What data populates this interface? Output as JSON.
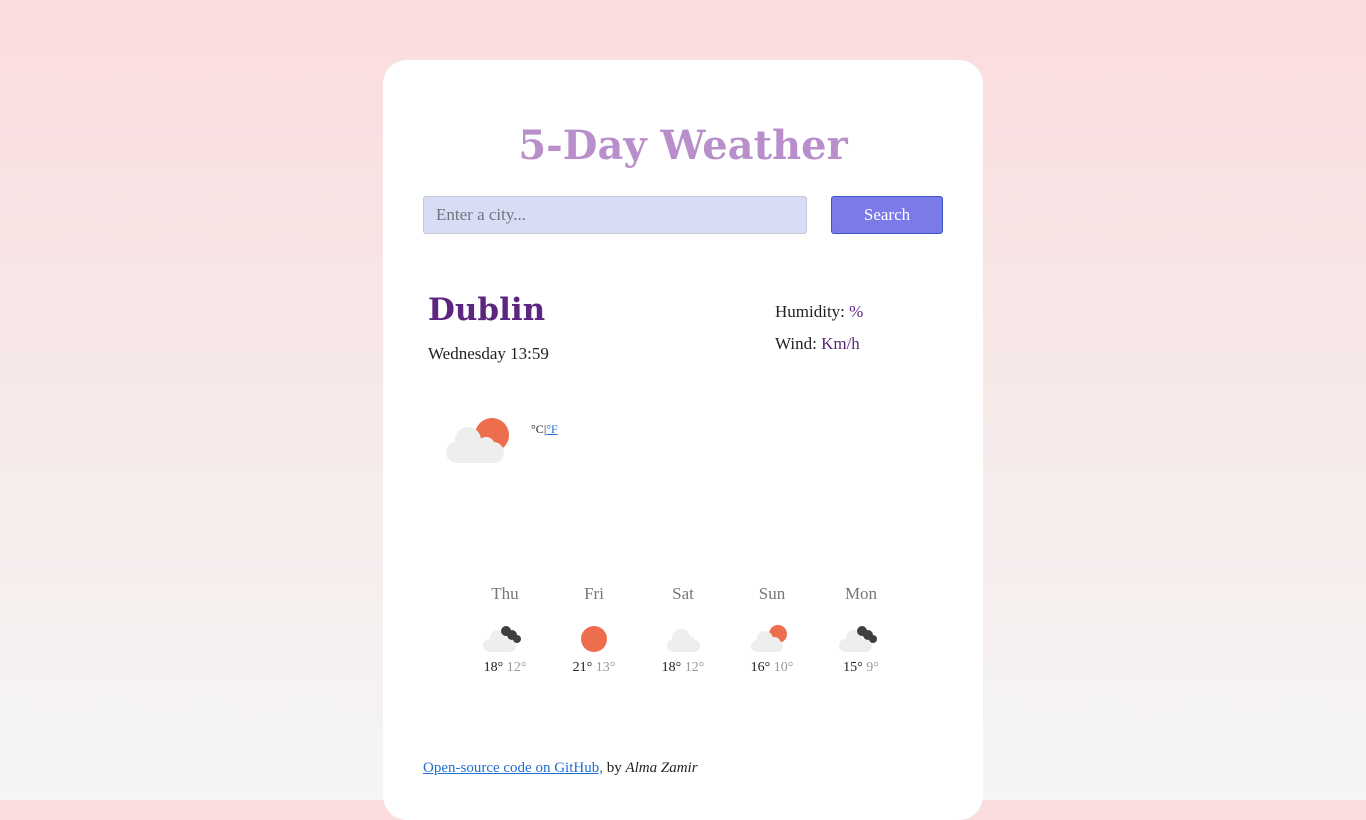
{
  "header": {
    "title": "5-Day Weather"
  },
  "search": {
    "placeholder": "Enter a city...",
    "button_label": "Search"
  },
  "current": {
    "city": "Dublin",
    "datetime": "Wednesday 13:59",
    "humidity_label": "Humidity:",
    "humidity_value": "%",
    "wind_label": "Wind:",
    "wind_value": "Km/h",
    "icon": "partly-cloudy-day-icon",
    "unit_celsius": "°C",
    "unit_separator": "|",
    "unit_fahrenheit": "°F"
  },
  "forecast": [
    {
      "day": "Thu",
      "max": "18°",
      "min": "12°",
      "icon": "cloudy-night-icon"
    },
    {
      "day": "Fri",
      "max": "21°",
      "min": "13°",
      "icon": "sun-icon"
    },
    {
      "day": "Sat",
      "max": "18°",
      "min": "12°",
      "icon": "cloud-icon"
    },
    {
      "day": "Sun",
      "max": "16°",
      "min": "10°",
      "icon": "partly-cloudy-day-icon"
    },
    {
      "day": "Mon",
      "max": "15°",
      "min": "9°",
      "icon": "cloudy-night-icon"
    }
  ],
  "footer": {
    "link_text": "Open-source code on GitHub,",
    "by_text": " by ",
    "author": "Alma Zamir"
  },
  "colors": {
    "title": "#b98fcb",
    "city": "#5c2580",
    "button": "#7a7ae9",
    "input": "#d6ddf4",
    "sun": "#ec6e4c"
  }
}
